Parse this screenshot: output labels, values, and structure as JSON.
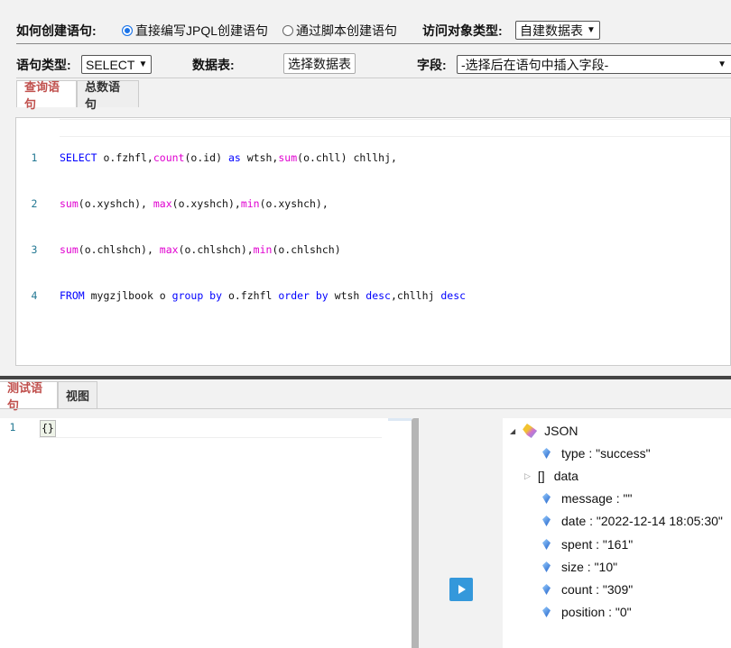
{
  "row1": {
    "label": "如何创建语句:",
    "radio_jpql": "直接编写JPQL创建语句",
    "radio_script": "通过脚本创建语句",
    "access_label": "访问对象类型:",
    "access_value": "自建数据表"
  },
  "row2": {
    "type_label": "语句类型:",
    "type_value": "SELECT",
    "table_label": "数据表:",
    "table_button": "选择数据表",
    "field_label": "字段:",
    "field_value": "-选择后在语句中插入字段-"
  },
  "tabs_top": [
    "查询语句",
    "总数语句"
  ],
  "query_lines": [
    {
      "n": "1"
    },
    {
      "n": "2"
    },
    {
      "n": "3"
    },
    {
      "n": "4"
    }
  ],
  "query_tokens": {
    "l1": [
      "SELECT",
      " o.fzhfl,",
      "count",
      "(o.id) ",
      "as",
      " wtsh,",
      "sum",
      "(o.chll) chllhj,"
    ],
    "l2": [
      "sum",
      "(o.xyshch), ",
      "max",
      "(o.xyshch),",
      "min",
      "(o.xyshch),"
    ],
    "l3": [
      "sum",
      "(o.chlshch), ",
      "max",
      "(o.chlshch),",
      "min",
      "(o.chlshch)"
    ],
    "l4": [
      "FROM",
      " mygzjlbook o ",
      "group by",
      " o.fzhfl ",
      "order by",
      " wtsh ",
      "desc",
      ",chllhj ",
      "desc"
    ]
  },
  "tabs_bottom": [
    "测试语句",
    "视图"
  ],
  "test_editor": {
    "line": "1",
    "content": "{}"
  },
  "json_tree": {
    "root": "JSON",
    "items": [
      "type : \"success\"",
      "data",
      "message : \"\"",
      "date : \"2022-12-14 18:05:30\"",
      "spent : \"161\"",
      "size : \"10\"",
      "count : \"309\"",
      "position : \"0\""
    ],
    "data_prefix": "[]"
  },
  "colors": {
    "accent": "#c0504d",
    "run": "#3498db"
  }
}
